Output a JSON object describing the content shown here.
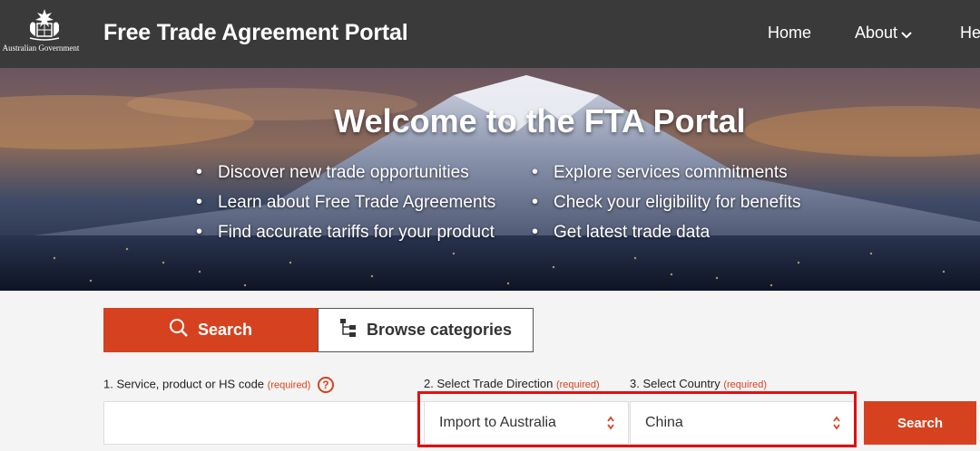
{
  "header": {
    "logo_text": "Australian Government",
    "title": "Free Trade Agreement Portal",
    "nav": {
      "home": "Home",
      "about": "About",
      "help": "He"
    }
  },
  "hero": {
    "title": "Welcome to the FTA Portal",
    "bullets_left": [
      "Discover new trade opportunities",
      "Learn about Free Trade Agreements",
      "Find accurate tariffs for your product"
    ],
    "bullets_right": [
      "Explore services commitments",
      "Check your eligibility for benefits",
      "Get latest trade data"
    ]
  },
  "search": {
    "tab_search": "Search",
    "tab_browse": "Browse categories",
    "label_product": "1. Service, product or HS code",
    "label_direction": "2. Select Trade Direction",
    "label_country": "3. Select Country",
    "required": "(required)",
    "help_glyph": "?",
    "product_value": "",
    "direction_value": "Import to Australia",
    "country_value": "China",
    "submit": "Search"
  },
  "colors": {
    "accent": "#d6421f",
    "header": "#3a3a3a",
    "highlight": "#e01010"
  }
}
